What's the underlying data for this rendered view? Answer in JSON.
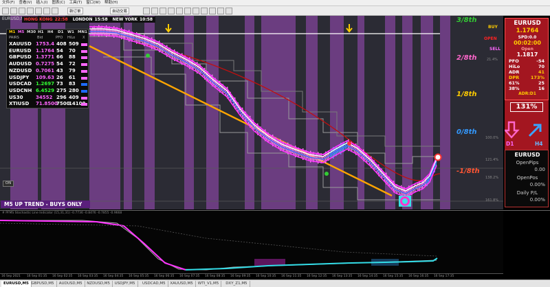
{
  "menu": [
    "文件(F)",
    "查看(V)",
    "插入(I)",
    "图表(C)",
    "工具(T)",
    "窗口(W)",
    "帮助(H)"
  ],
  "toolbar": {
    "new_order": "新订单",
    "auto_trade": "自动交易"
  },
  "chart_title": "EURUSD,M5",
  "sessions": [
    {
      "city": "HONG KONG",
      "time": "22:58"
    },
    {
      "city": "LONDON",
      "time": "15:58"
    },
    {
      "city": "NEW YORK",
      "time": "10:58"
    }
  ],
  "dashboard": {
    "timeframes": [
      "M1",
      "M5",
      "M30",
      "H1",
      "H4",
      "D1",
      "W1",
      "MN1"
    ],
    "headers": [
      "PAIRS",
      "Bid",
      "PFO",
      "HiLo",
      "X"
    ],
    "rows": [
      {
        "pair": "XAUUSD",
        "bid": "1753.4",
        "pfo": "408",
        "hilo": "509",
        "color": "#ff66ff",
        "bar": "#ff66ff"
      },
      {
        "pair": "EURUSD",
        "bid": "1.1764",
        "pfo": "54",
        "hilo": "70",
        "color": "#ff66ff",
        "bar": "#ff66ff"
      },
      {
        "pair": "GBPUSD",
        "bid": "1.3771",
        "pfo": "66",
        "hilo": "88",
        "color": "#ff66ff",
        "bar": "#ff66ff"
      },
      {
        "pair": "AUDUSD",
        "bid": "0.7275",
        "pfo": "54",
        "hilo": "72",
        "color": "#ff66ff",
        "bar": "#ff66ff"
      },
      {
        "pair": "NZDUSD",
        "bid": "0.7061",
        "pfo": "43",
        "hilo": "79",
        "color": "#ff66ff",
        "bar": "#ff66ff"
      },
      {
        "pair": "USDJPY",
        "bid": "109.63",
        "pfo": "26",
        "hilo": "61",
        "color": "#ff66ff",
        "bar": "#ff66ff"
      },
      {
        "pair": "USDCAD",
        "bid": "1.2697",
        "pfo": "73",
        "hilo": "83",
        "color": "#33ff33",
        "bar": "#1e6bff"
      },
      {
        "pair": "USDCNH",
        "bid": "6.4529",
        "pfo": "275",
        "hilo": "280",
        "color": "#33ff33",
        "bar": "#1e6bff"
      },
      {
        "pair": "US30",
        "bid": "34552",
        "pfo": "296",
        "hilo": "409",
        "color": "#ff66ff",
        "bar": "#ff66ff"
      },
      {
        "pair": "XTIUSD",
        "bid": "71.8500",
        "pfo": "7500",
        "hilo": "14100",
        "color": "#ff66ff",
        "bar": "#ff66ff"
      }
    ]
  },
  "fib_labels": [
    {
      "text": "3/8th",
      "color": "#33cc33"
    },
    {
      "text": "2/8th",
      "color": "#ff66cc"
    },
    {
      "text": "1/8th",
      "color": "#ffcc00"
    },
    {
      "text": "0/8th",
      "color": "#3399ff"
    },
    {
      "text": "-1/8th",
      "color": "#ff5533"
    }
  ],
  "trade_labels": [
    {
      "text": "BUY",
      "color": "#ffcc00"
    },
    {
      "text": "OPEN",
      "color": "#ff2222"
    },
    {
      "text": "SELL",
      "color": "#ff66ff"
    }
  ],
  "axis_values": [
    "21.4%",
    "100.0%",
    "121.4%",
    "138.2%",
    "161.8%"
  ],
  "price_ticks": [
    "1.1817",
    "1.1805",
    "1.1794",
    "1.1783",
    "1.1772",
    "1.1761"
  ],
  "info_panel": {
    "symbol": "EURUSD",
    "price": "1.1764",
    "spd": "SPD:0.0",
    "timer": "00:02:00",
    "open_label": "Open",
    "open_value": "1.1817",
    "rows": [
      {
        "label": "PFO",
        "value": "-54",
        "color": "#ffffff"
      },
      {
        "label": "HiLo",
        "value": "70",
        "color": "#ffffff"
      },
      {
        "label": "ADR",
        "value": "41",
        "color": "#ffcc00"
      },
      {
        "label": "DPR",
        "value": "173%",
        "color": "#ffcc00"
      }
    ],
    "stats": [
      {
        "left": "61%",
        "right": "25"
      },
      {
        "left": "38%",
        "right": "16"
      }
    ],
    "adr_label": "ADR:D1",
    "adr_value": "131%"
  },
  "arrows": {
    "left_label": "D1",
    "right_label": "H4"
  },
  "position_panel": {
    "symbol": "EURUSD",
    "open_pips_label": "OpenPips",
    "open_pips_value": "0.00",
    "open_pos_label": "OpenPos",
    "open_pos_value": "0.00%",
    "daily_label": "Daily P/L",
    "daily_value": "0.00%"
  },
  "trend_banner": "M5 UP TREND - BUYS ONLY",
  "on_button": "ON",
  "sub_window_title": "# PFMS Stochastic Line Indicator (15,31,31)  -0.7736 -0.8476 -0.7855 -0.9668",
  "time_labels": [
    "16 Sep 2021",
    "16 Sep 01:35",
    "16 Sep 02:35",
    "16 Sep 03:35",
    "16 Sep 04:35",
    "16 Sep 05:35",
    "16 Sep 06:35",
    "16 Sep 07:35",
    "16 Sep 08:35",
    "16 Sep 09:35",
    "16 Sep 10:35",
    "16 Sep 11:35",
    "16 Sep 12:35",
    "16 Sep 13:35",
    "16 Sep 14:35",
    "16 Sep 15:35",
    "16 Sep 16:35",
    "16 Sep 17:35"
  ],
  "tabs": [
    "EURUSD,M5",
    "GBPUSD,M5",
    "AUDUSD,M5",
    "NZDUSD,M5",
    "USDJPY,M5",
    "USDCAD,M5",
    "XAUUSD,M5",
    "WTI_V1,M5",
    "DXY_Z1,M5"
  ],
  "colors": {
    "purple_band": "#6b3d80",
    "dark_band": "#2b2b34",
    "candles": "#ff88ee",
    "ma_white": "#ffffff",
    "ma_blue": "#3a6bff",
    "fast_ma": "#ff33ff",
    "trend_line": "#ffa500",
    "red_ma": "#c01010",
    "envelope": "#9a9a9a"
  }
}
